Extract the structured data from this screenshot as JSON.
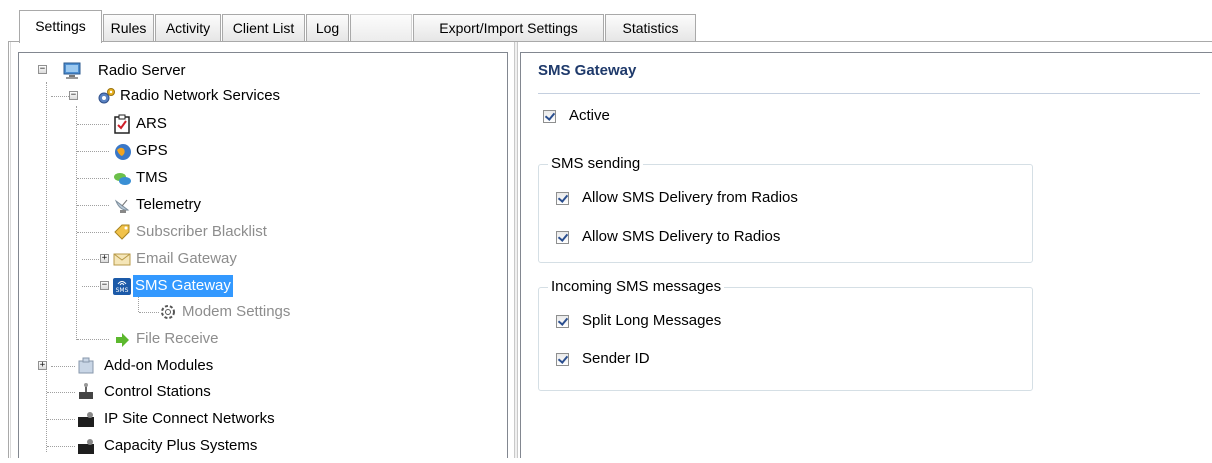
{
  "tabs": [
    {
      "label": "Settings",
      "active": true
    },
    {
      "label": "Rules"
    },
    {
      "label": "Activity"
    },
    {
      "label": "Client List"
    },
    {
      "label": "Log"
    },
    {
      "label": "Export/Import Settings"
    },
    {
      "label": "Statistics"
    }
  ],
  "tree": {
    "radio_server": "Radio Server",
    "radio_network_services": "Radio Network Services",
    "ars": "ARS",
    "gps": "GPS",
    "tms": "TMS",
    "telemetry": "Telemetry",
    "subscriber_blacklist": "Subscriber Blacklist",
    "email_gateway": "Email Gateway",
    "sms_gateway": "SMS Gateway",
    "modem_settings": "Modem Settings",
    "file_receive": "File Receive",
    "addon_modules": "Add-on Modules",
    "control_stations": "Control Stations",
    "ip_site_connect": "IP Site Connect Networks",
    "capacity_plus": "Capacity Plus Systems",
    "selected": "SMS Gateway"
  },
  "panel": {
    "title": "SMS Gateway",
    "active": {
      "label": "Active",
      "checked": true
    },
    "sms_sending": {
      "legend": "SMS sending",
      "allow_from": {
        "label": "Allow SMS Delivery from Radios",
        "checked": true
      },
      "allow_to": {
        "label": "Allow SMS Delivery to Radios",
        "checked": true
      }
    },
    "incoming": {
      "legend": "Incoming SMS messages",
      "split_long": {
        "label": "Split Long Messages",
        "checked": true
      },
      "sender_id": {
        "label": "Sender ID",
        "checked": true
      }
    }
  },
  "colors": {
    "selection": "#3399ff",
    "title": "#1f3a6b",
    "disabled_text": "#8d8d8d"
  }
}
